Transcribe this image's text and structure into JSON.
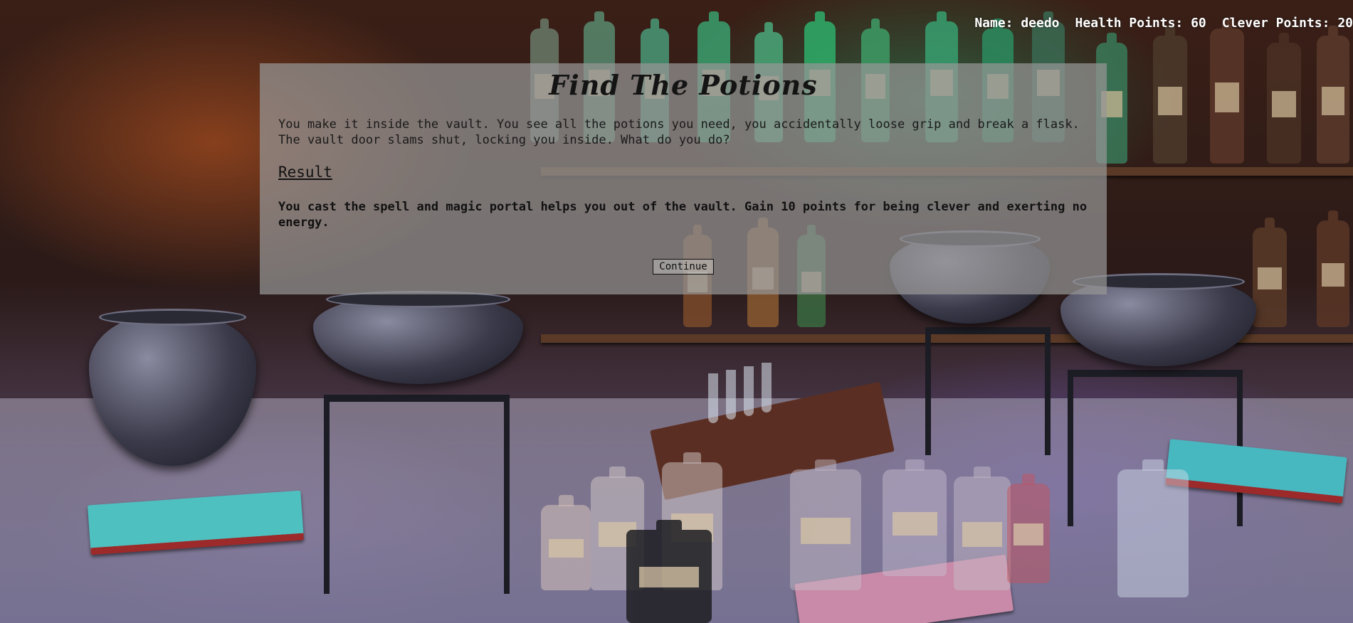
{
  "status": {
    "name": "Name: deedo",
    "health": "Health Points: 60",
    "clever": "Clever Points: 20"
  },
  "dialog": {
    "title": "Find The Potions",
    "story": "You make it inside the vault. You see all the potions you need, you accidentally loose grip and break a flask. The vault door slams shut, locking you inside. What do you do?",
    "result_heading": "Result",
    "result_text": "You cast the spell and magic portal helps you out of the vault. Gain 10 points for being clever and exerting no energy.",
    "continue_label": "Continue"
  },
  "background": {
    "description_icon": "potions-classroom-background"
  }
}
